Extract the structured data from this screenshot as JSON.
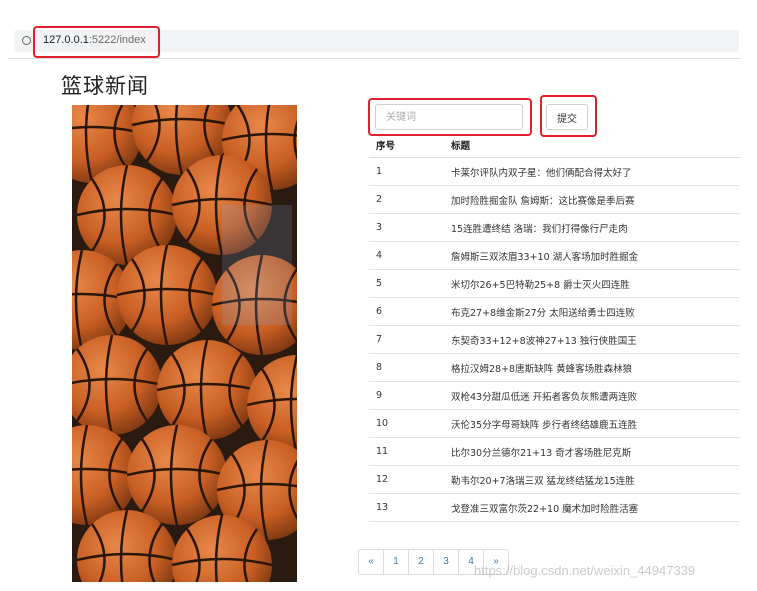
{
  "browser": {
    "url_host": "127.0.0.1",
    "url_rest": ":5222/index"
  },
  "page": {
    "title": "篮球新闻"
  },
  "search": {
    "placeholder": "关键词",
    "value": "",
    "submit_label": "提交"
  },
  "table": {
    "headers": [
      "序号",
      "标题"
    ],
    "rows": [
      {
        "num": "1",
        "title": "卡莱尔评队内双子星：他们俩配合得太好了"
      },
      {
        "num": "2",
        "title": "加时险胜掘金队 詹姆斯：这比赛像是季后赛"
      },
      {
        "num": "3",
        "title": "15连胜遭终结 洛瑞：我们打得像行尸走肉"
      },
      {
        "num": "4",
        "title": "詹姆斯三双浓眉33+10 湖人客场加时胜掘金"
      },
      {
        "num": "5",
        "title": "米切尔26+5巴特勒25+8 爵士灭火四连胜"
      },
      {
        "num": "6",
        "title": "布克27+8维金斯27分 太阳送给勇士四连败"
      },
      {
        "num": "7",
        "title": "东契奇33+12+8波神27+13 独行侠胜国王"
      },
      {
        "num": "8",
        "title": "格拉汉姆28+8唐斯缺阵 黄蜂客场胜森林狼"
      },
      {
        "num": "9",
        "title": "双枪43分甜瓜低迷 开拓者客负灰熊遭两连败"
      },
      {
        "num": "10",
        "title": "沃伦35分字母哥缺阵 步行者终结雄鹿五连胜"
      },
      {
        "num": "11",
        "title": "比尔30分兰德尔21+13 奇才客场胜尼克斯"
      },
      {
        "num": "12",
        "title": "勒韦尔20+7洛瑞三双 猛龙终结猛龙15连胜"
      },
      {
        "num": "13",
        "title": "戈登准三双富尔茨22+10 魔术加时险胜活塞"
      }
    ]
  },
  "pagination": {
    "prev": "«",
    "pages": [
      "1",
      "2",
      "3",
      "4"
    ],
    "next": "»"
  },
  "watermark": "https://blog.csdn.net/weixin_44947339",
  "colors": {
    "annotation": "#e0202a",
    "link": "#337ab7",
    "ball_orange": "#d2692a"
  },
  "image": {
    "subject": "basketballs"
  }
}
